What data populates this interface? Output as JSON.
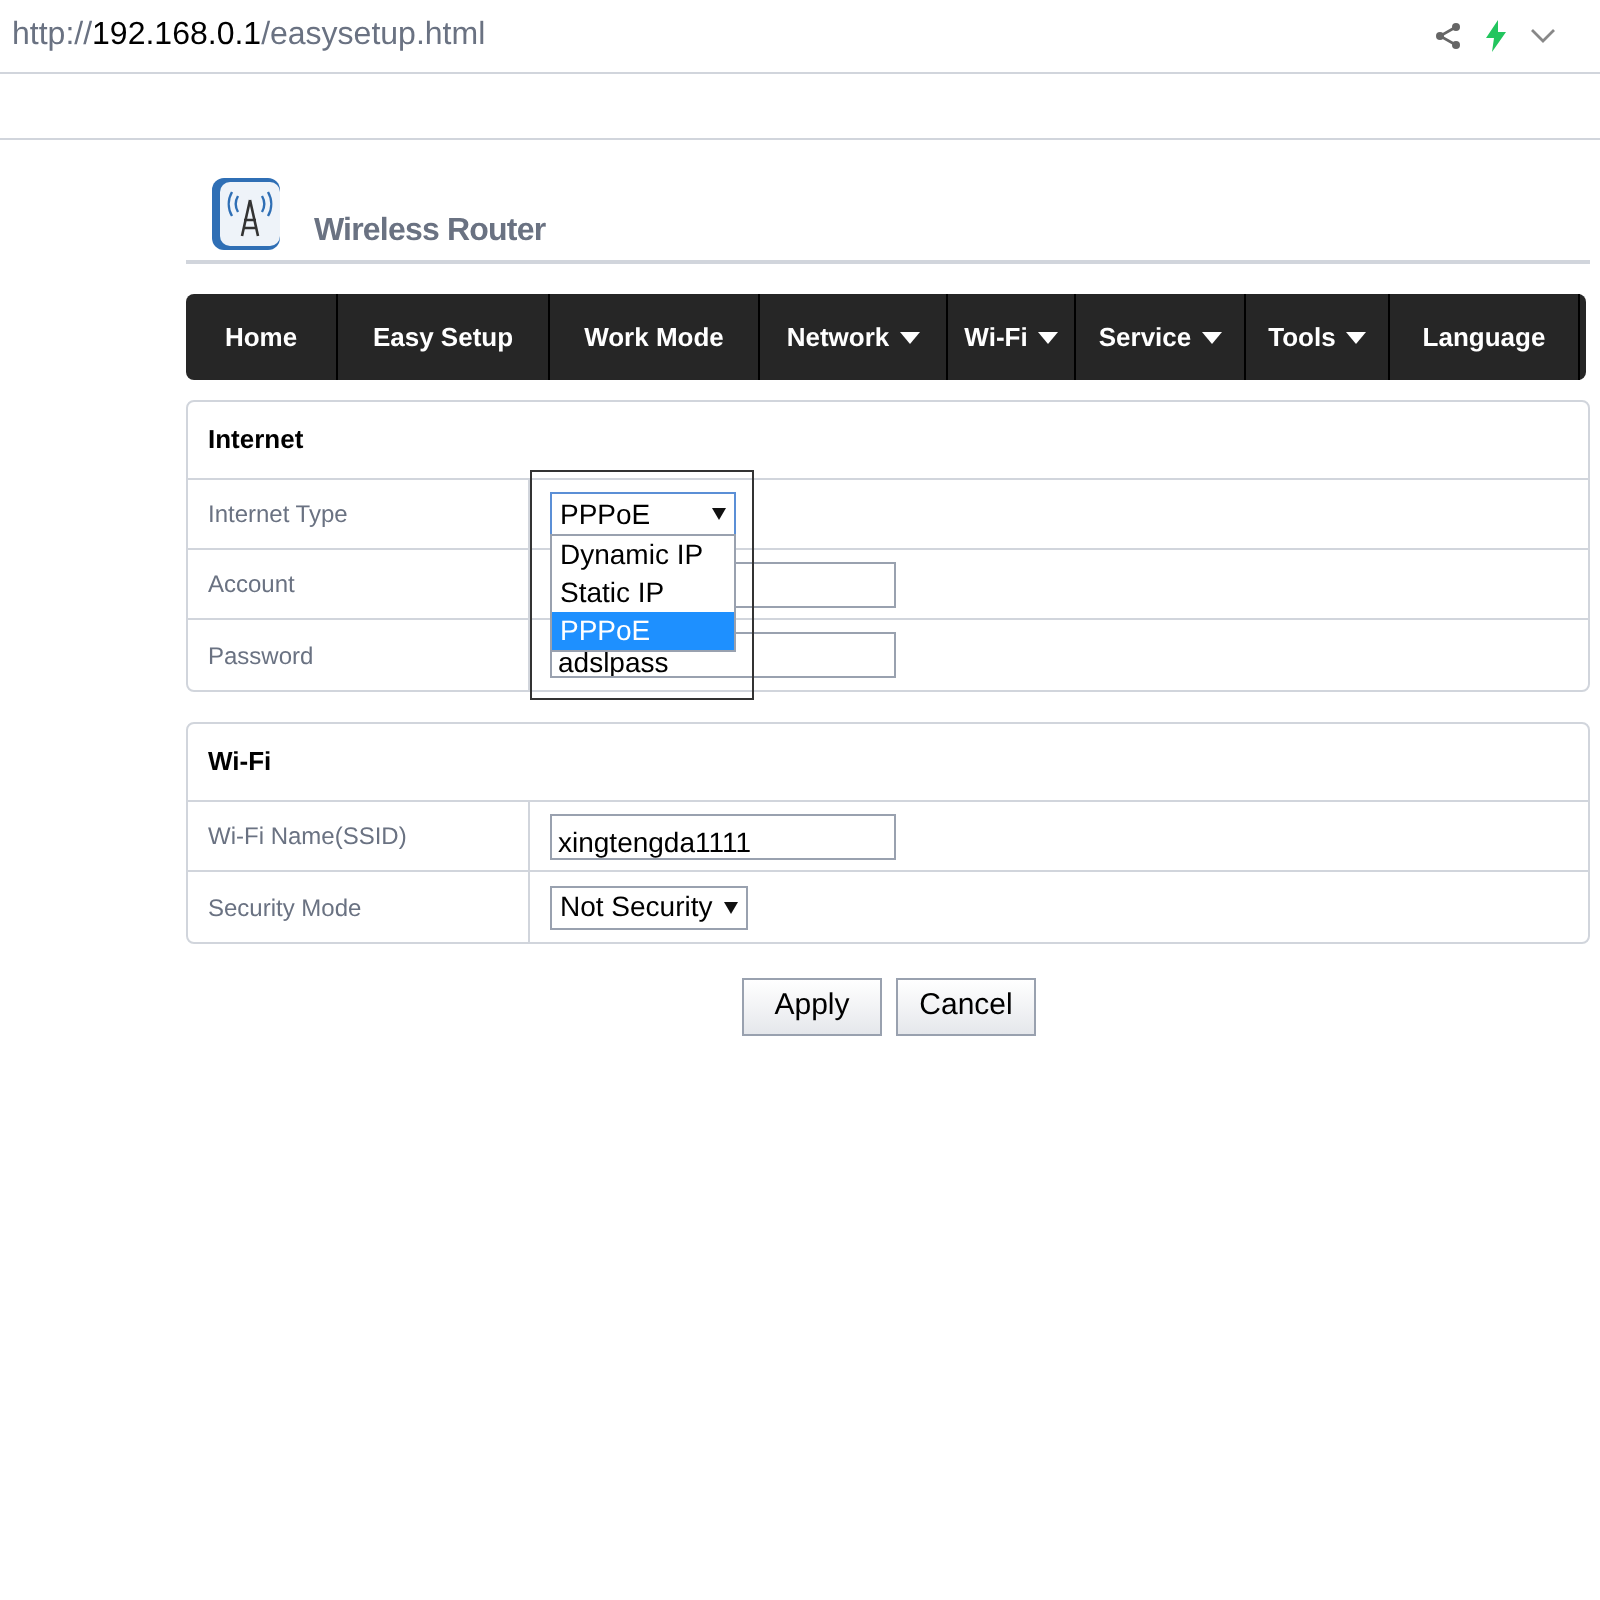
{
  "address_bar": {
    "scheme": "http://",
    "host": "192.168.0.1",
    "path": "/easysetup.html"
  },
  "header": {
    "title": "Wireless Router"
  },
  "nav": [
    {
      "label": "Home",
      "has_menu": false
    },
    {
      "label": "Easy Setup",
      "has_menu": false
    },
    {
      "label": "Work Mode",
      "has_menu": false
    },
    {
      "label": "Network",
      "has_menu": true
    },
    {
      "label": "Wi-Fi",
      "has_menu": true
    },
    {
      "label": "Service",
      "has_menu": true
    },
    {
      "label": "Tools",
      "has_menu": true
    },
    {
      "label": "Language",
      "has_menu": false
    }
  ],
  "sections": [
    {
      "title": "Internet",
      "rows": [
        {
          "kind": "select",
          "label": "Internet Type",
          "value": "PPPoE",
          "expanded": true,
          "options": [
            {
              "label": "Dynamic IP",
              "selected": false
            },
            {
              "label": "Static IP",
              "selected": false
            },
            {
              "label": "PPPoE",
              "selected": true
            }
          ]
        },
        {
          "kind": "input",
          "label": "Account"
        },
        {
          "kind": "input",
          "label": "Password",
          "value": "adslpass"
        }
      ]
    },
    {
      "title": "Wi-Fi",
      "rows": [
        {
          "kind": "input",
          "label": "Wi-Fi Name(SSID)",
          "value": "xingtengda1111"
        },
        {
          "kind": "select",
          "label": "Security Mode",
          "value": "Not Security",
          "expanded": false
        }
      ]
    }
  ],
  "buttons": [
    "Apply",
    "Cancel"
  ]
}
